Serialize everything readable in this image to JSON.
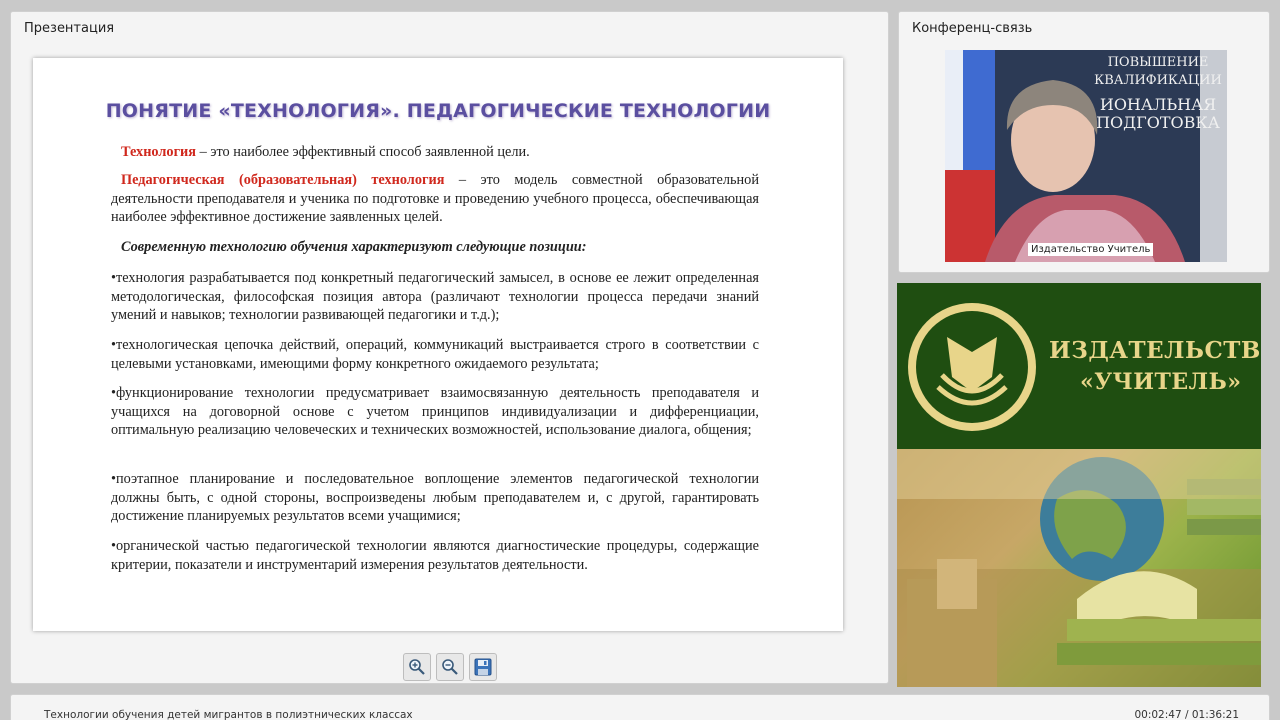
{
  "presentation": {
    "panel_title": "Презентация",
    "slide": {
      "title": "ПОНЯТИЕ «ТЕХНОЛОГИЯ». ПЕДАГОГИЧЕСКИЕ ТЕХНОЛОГИИ",
      "p1_term": "Технология",
      "p1_text": " – это наиболее эффективный способ заявленной цели.",
      "p2_term": "Педагогическая (образовательная) технология",
      "p2_text": " – это модель совместной образовательной деятельности преподавателя и ученика по подготовке и проведению учебного процесса, обеспечивающая наиболее эффективное достижение заявленных целей.",
      "p3": "Современную технологию обучения характеризуют следующие позиции:",
      "bullets": [
        "•технология разрабатывается под конкретный педагогический замысел, в основе ее лежит определенная методологическая, философская позиция автора (различают технологии процесса передачи знаний умений и навыков; технологии развивающей педагогики и т.д.);",
        "•технологическая цепочка действий, операций, коммуникаций выстраивается строго в соответствии с целевыми установками, имеющими форму конкретного ожидаемого результата;",
        "•функционирование технологии предусматривает взаимосвязанную деятельность преподавателя и учащихся на договорной основе с учетом принципов индивидуализации и дифференциации, оптимальную реализацию человеческих и технических возможностей, использование диалога, общения;",
        "•поэтапное планирование и последовательное воплощение элементов педагогической технологии должны быть, с одной стороны, воспроизведены любым преподавателем и, с другой, гарантировать достижение планируемых результатов всеми учащимися;",
        "•органической частью педагогической технологии являются диагностические процедуры, содержащие критерии, показатели и инструментарий измерения результатов деятельности."
      ]
    },
    "toolbar": {
      "zoom_in_icon": "zoom-in-icon",
      "zoom_out_icon": "zoom-out-icon",
      "save_icon": "save-icon"
    }
  },
  "conference": {
    "panel_title": "Конференц-связь",
    "video_caption": "Издательство Учитель",
    "backdrop_lines": [
      "ПОВЫШЕНИЕ",
      "КВАЛИФИКАЦИИ",
      "ИОНАЛЬНАЯ",
      "ПОДГОТОВКА"
    ]
  },
  "ad": {
    "brand_line1": "ИЗДАТЕЛЬСТВО",
    "brand_line2": "«УЧИТЕЛЬ»",
    "colors": {
      "green": "#1f4e11",
      "gold": "#e8d58a"
    }
  },
  "footer": {
    "lecture_title": "Технологии обучения детей мигрантов в полиэтнических классах",
    "timecode": "00:02:47 / 01:36:21"
  }
}
